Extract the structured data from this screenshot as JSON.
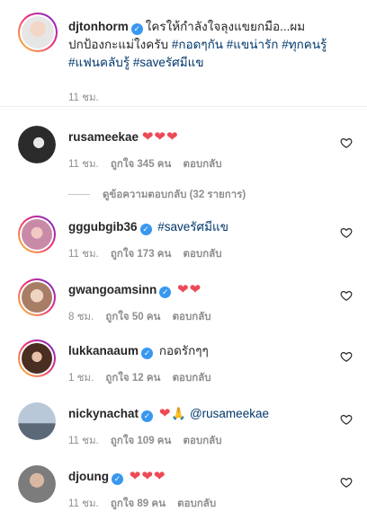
{
  "caption": {
    "username": "djtonhorm",
    "text_line1": "ใครให้กำลังใจลุงแขยกมือ...ผม",
    "text_line2_plain": "ปกป้องกะแม่ใงครับ ",
    "tags_line2": "#กอดๆกัน #แขน่ารัก #ทุกคนรู้",
    "tags_line3": "#แฟนคลับรู้ #saveรัศมีแข",
    "time": "11 ชม."
  },
  "replies_toggle": "ดูข้อความตอบกลับ (32 รายการ)",
  "comments": [
    {
      "username": "rusameekae",
      "verified": false,
      "text": "",
      "hearts": "❤❤❤",
      "time": "11 ชม.",
      "likes": "ถูกใจ 345 คน",
      "reply": "ตอบกลับ",
      "avatar_color": "#2b2b2b"
    },
    {
      "username": "gggubgib36",
      "verified": true,
      "text": "#saveรัศมีแข",
      "hearts": "",
      "time": "11 ชม.",
      "likes": "ถูกใจ 173 คน",
      "reply": "ตอบกลับ",
      "avatar_color": "#d6a4b8"
    },
    {
      "username": "gwangoamsinn",
      "verified": true,
      "text": "",
      "hearts": "❤❤",
      "time": "8 ชม.",
      "likes": "ถูกใจ 50 คน",
      "reply": "ตอบกลับ",
      "avatar_color": "#c9a48c"
    },
    {
      "username": "lukkanaaum",
      "verified": true,
      "text": "กอดรักๆๆ",
      "hearts": "",
      "time": "1 ชม.",
      "likes": "ถูกใจ 12 คน",
      "reply": "ตอบกลับ",
      "avatar_color": "#5a3a2c"
    },
    {
      "username": "nickynachat",
      "verified": true,
      "text": "",
      "hearts": "❤",
      "pray": "🙏",
      "mention": "@rusameekae",
      "time": "11 ชม.",
      "likes": "ถูกใจ 109 คน",
      "reply": "ตอบกลับ",
      "avatar_color": "#8fa3b8"
    },
    {
      "username": "djoung",
      "verified": true,
      "text": "",
      "hearts": "❤❤❤",
      "time": "11 ชม.",
      "likes": "ถูกใจ 89 คน",
      "reply": "ตอบกลับ",
      "avatar_color": "#6e6e6e"
    }
  ],
  "colors": {
    "heart": "#ed4956",
    "link": "#00376b",
    "meta": "#8e8e8e",
    "verified": "#3897f0"
  },
  "icons": {
    "like": "heart-outline-icon",
    "verified": "verified-badge-icon"
  }
}
